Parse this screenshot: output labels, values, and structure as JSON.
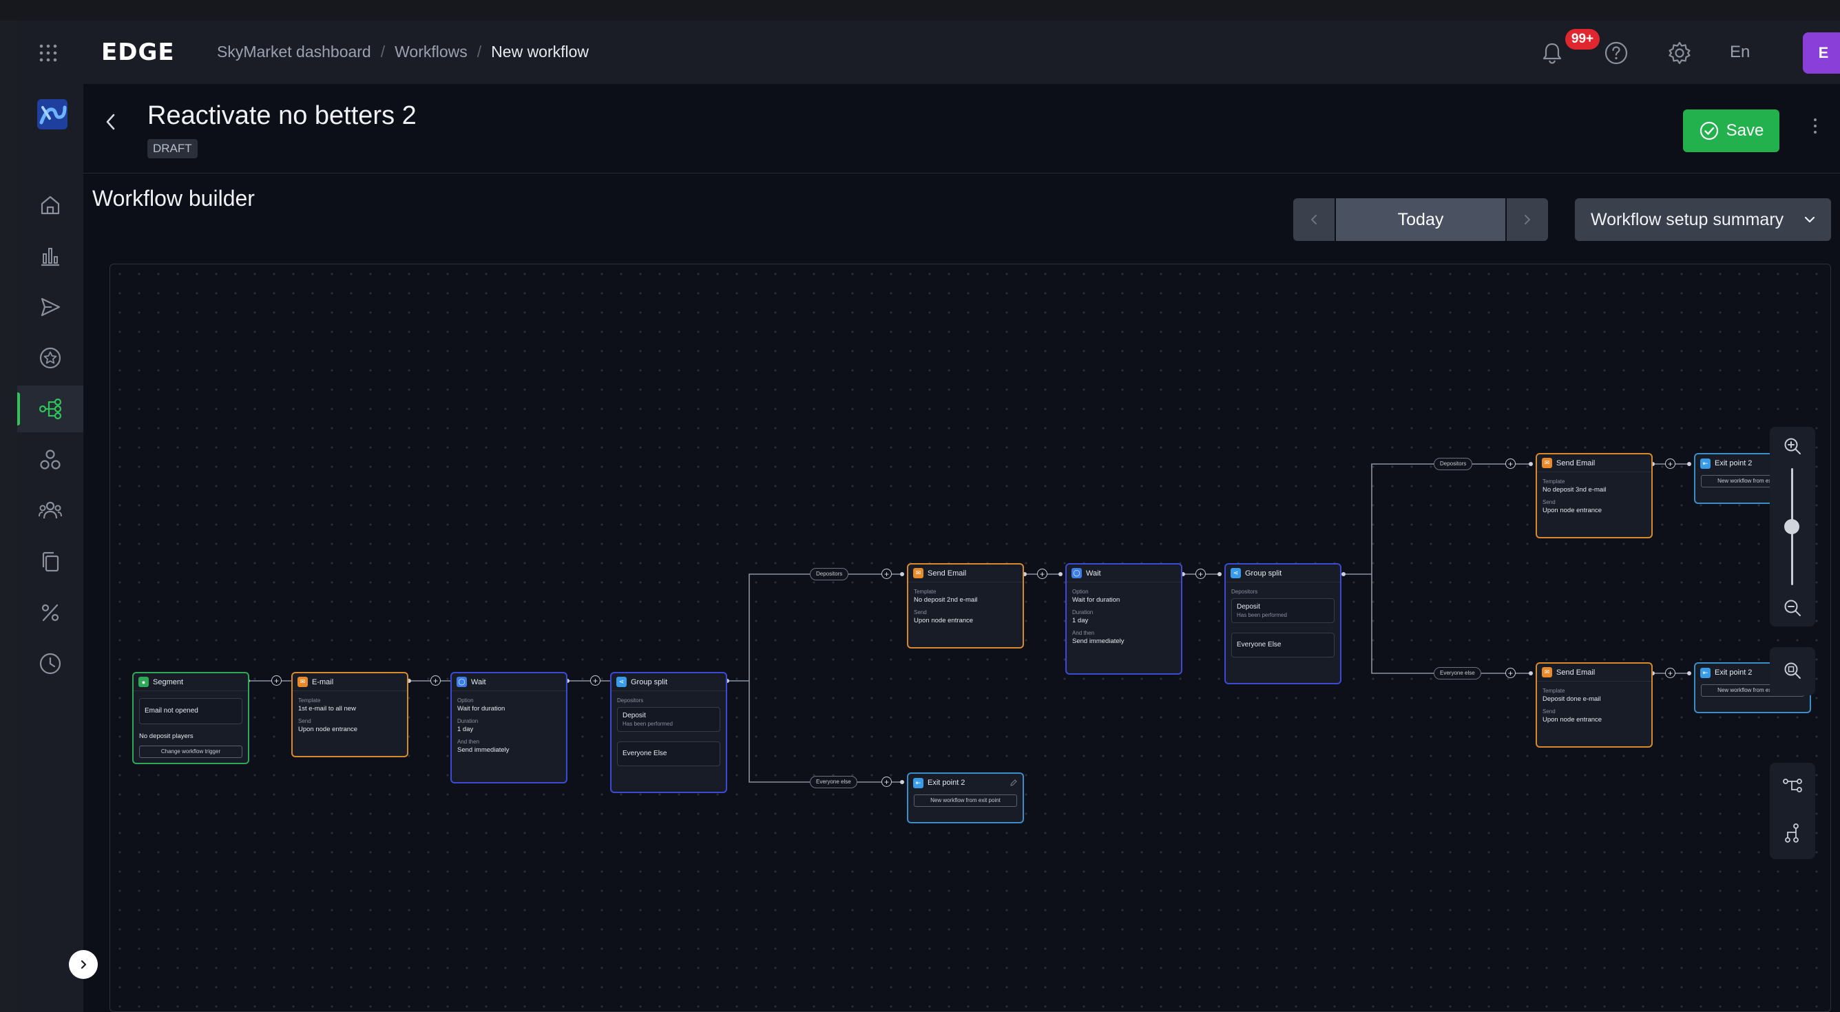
{
  "topbar": {
    "logo": "EDGE",
    "breadcrumb": [
      "SkyMarket dashboard",
      "Workflows",
      "New workflow"
    ],
    "separator": "/",
    "notifications_badge": "99+",
    "language": "En",
    "avatar_initial": "E"
  },
  "header": {
    "title": "Reactivate no betters 2",
    "status": "DRAFT",
    "save_label": "Save"
  },
  "builder": {
    "title": "Workflow builder",
    "date_label": "Today",
    "summary_label": "Workflow setup summary"
  },
  "nodes": {
    "segment": {
      "title": "Segment",
      "cond1": "Email not opened",
      "cond2": "No deposit players",
      "button": "Change workflow trigger"
    },
    "email1": {
      "title": "E-mail",
      "template_label": "Template",
      "template": "1st e-mail to all new",
      "send_label": "Send",
      "send": "Upon node entrance"
    },
    "wait1": {
      "title": "Wait",
      "option_label": "Option",
      "option": "Wait for duration",
      "duration_label": "Duration",
      "duration": "1 day",
      "then_label": "And then",
      "then": "Send immediately"
    },
    "split1": {
      "title": "Group split",
      "group_label": "Depositors",
      "branch1": "Deposit",
      "branch1_sub": "Has been performed",
      "branch2": "Everyone Else"
    },
    "send2": {
      "title": "Send Email",
      "template_label": "Template",
      "template": "No deposit 2nd e-mail",
      "send_label": "Send",
      "send": "Upon node entrance"
    },
    "exit1": {
      "title": "Exit point 2",
      "button": "New workflow from exit point"
    },
    "wait2": {
      "title": "Wait",
      "option_label": "Option",
      "option": "Wait for duration",
      "duration_label": "Duration",
      "duration": "1 day",
      "then_label": "And then",
      "then": "Send immediately"
    },
    "split2": {
      "title": "Group split",
      "group_label": "Depositors",
      "branch1": "Deposit",
      "branch1_sub": "Has been performed",
      "branch2": "Everyone Else"
    },
    "send3": {
      "title": "Send Email",
      "template_label": "Template",
      "template": "No deposit 3nd e-mail",
      "send_label": "Send",
      "send": "Upon node entrance"
    },
    "send4": {
      "title": "Send Email",
      "template_label": "Template",
      "template": "Deposit done e-mail",
      "send_label": "Send",
      "send": "Upon node entrance"
    },
    "exit2": {
      "title": "Exit point 2",
      "button": "New workflow from exit point"
    },
    "exit3": {
      "title": "Exit point 2",
      "button": "New workflow from exit point"
    }
  },
  "edge_labels": {
    "depositors": "Depositors",
    "everyone_else": "Everyone else"
  },
  "colors": {
    "accent_green": "#22b14c",
    "node_orange": "#d88a2c",
    "node_blue": "#3b4bd6",
    "node_green": "#2fa85a",
    "badge_red": "#e0262e",
    "avatar_purple": "#8b3fd9"
  },
  "icons": [
    "apps-grid-icon",
    "bell-icon",
    "help-icon",
    "gear-icon",
    "home-icon",
    "chart-icon",
    "send-icon",
    "star-icon",
    "workflow-icon",
    "segments-icon",
    "users-icon",
    "copy-icon",
    "percent-icon",
    "clock-icon",
    "chevron-left-icon",
    "chevron-right-icon",
    "chevron-down-icon",
    "zoom-in-icon",
    "zoom-out-icon",
    "zoom-fit-icon",
    "layout-horizontal-icon",
    "layout-vertical-icon",
    "edit-icon"
  ],
  "zoom": {
    "level_fraction": 0.5
  }
}
